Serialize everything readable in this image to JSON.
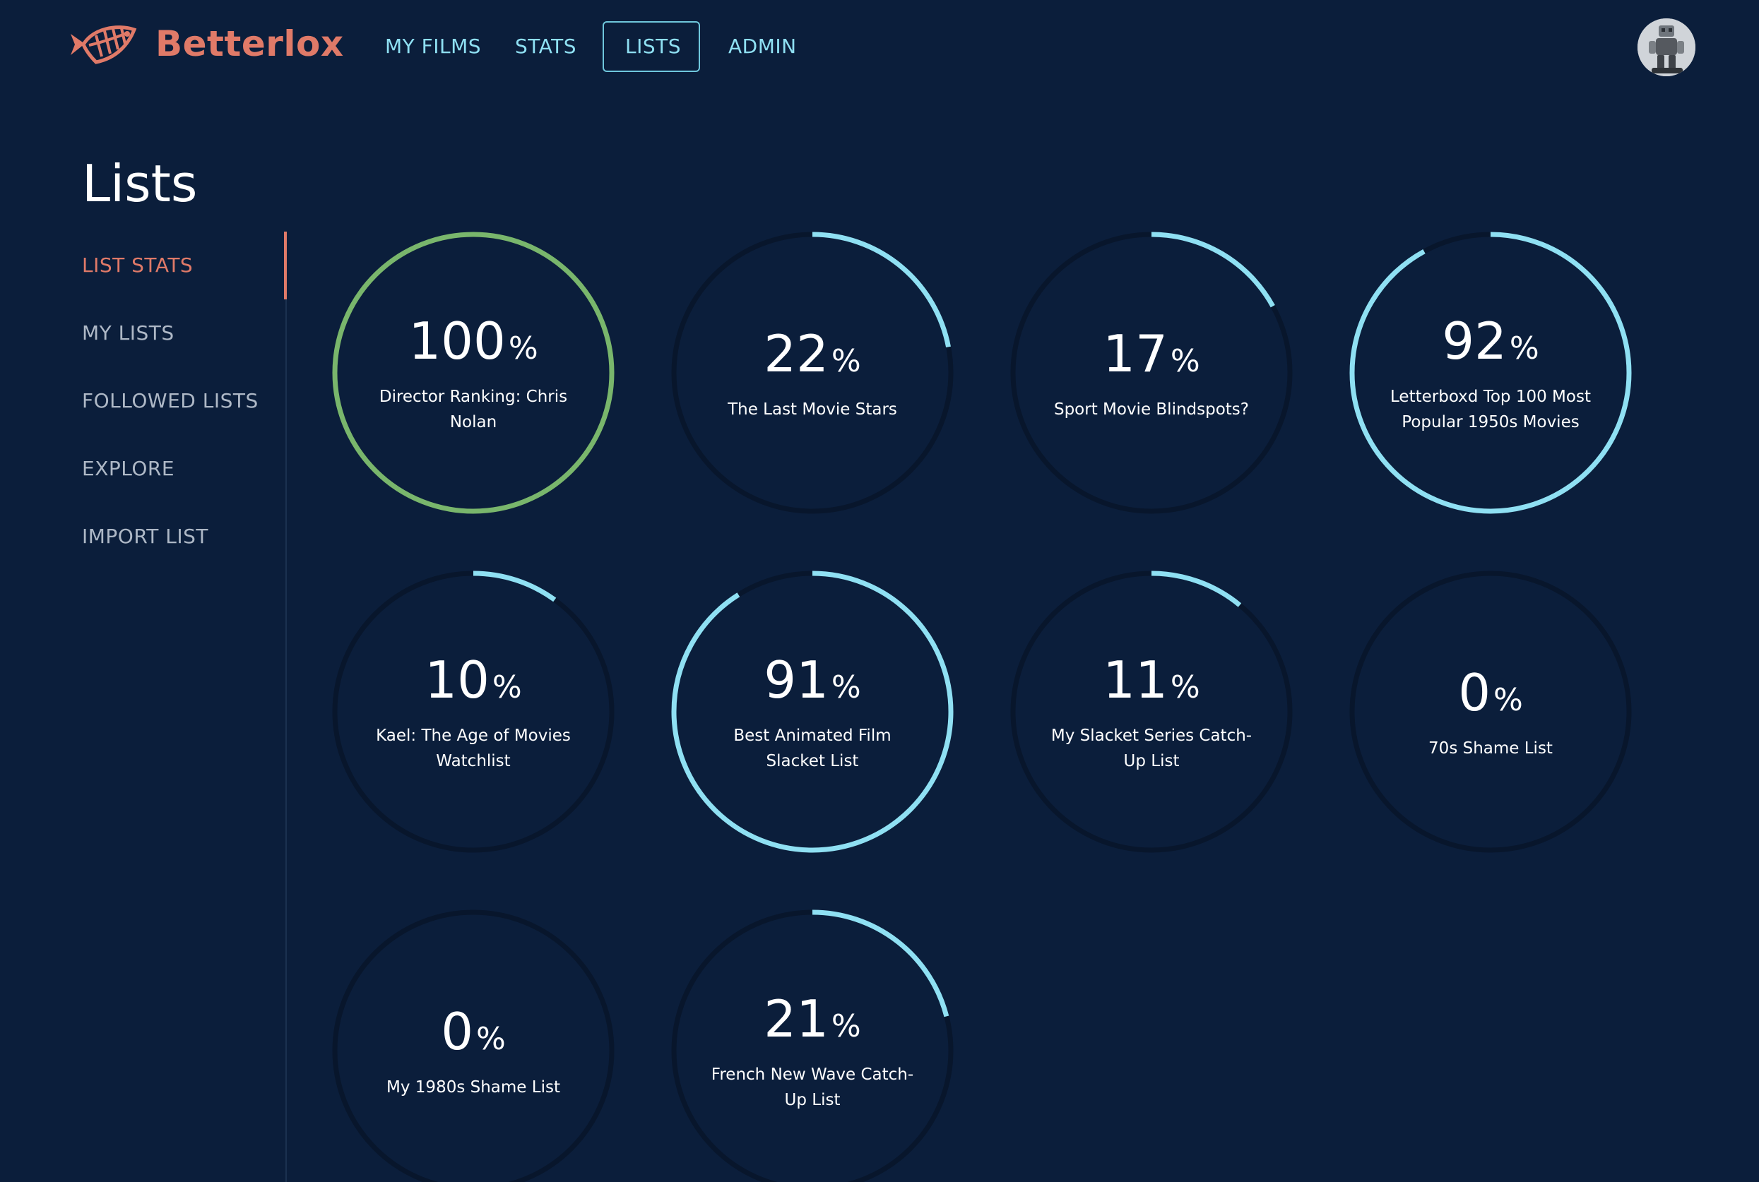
{
  "app": {
    "brand": "Betterlox",
    "logo_icon": "fish-skeleton-icon",
    "avatar_icon": "robot-avatar-icon"
  },
  "nav": {
    "items": [
      {
        "label": "MY FILMS",
        "active": false
      },
      {
        "label": "STATS",
        "active": false
      },
      {
        "label": "LISTS",
        "active": true
      },
      {
        "label": "ADMIN",
        "active": false
      }
    ]
  },
  "page": {
    "title": "Lists"
  },
  "sidebar": {
    "items": [
      {
        "label": "LIST STATS",
        "active": true
      },
      {
        "label": "MY LISTS",
        "active": false
      },
      {
        "label": "FOLLOWED LISTS",
        "active": false
      },
      {
        "label": "EXPLORE",
        "active": false
      },
      {
        "label": "IMPORT LIST",
        "active": false
      }
    ]
  },
  "colors": {
    "background": "#0b1e3b",
    "accent": "#e07a68",
    "nav_text": "#8fe0f3",
    "progress": "#8fe0f3",
    "complete": "#79b66c",
    "track": "#08162c"
  },
  "lists": [
    {
      "name": "Director Ranking: Chris Nolan",
      "percent": 100,
      "complete": true
    },
    {
      "name": "The Last Movie Stars",
      "percent": 22,
      "complete": false
    },
    {
      "name": "Sport Movie Blindspots?",
      "percent": 17,
      "complete": false
    },
    {
      "name": "Letterboxd Top 100 Most Popular 1950s Movies",
      "percent": 92,
      "complete": false
    },
    {
      "name": "Kael: The Age of Movies Watchlist",
      "percent": 10,
      "complete": false
    },
    {
      "name": "Best Animated Film Slacket List",
      "percent": 91,
      "complete": false
    },
    {
      "name": "My Slacket Series Catch-Up List",
      "percent": 11,
      "complete": false
    },
    {
      "name": "70s Shame List",
      "percent": 0,
      "complete": false
    },
    {
      "name": "My 1980s Shame List",
      "percent": 0,
      "complete": false
    },
    {
      "name": "French New Wave Catch-Up List",
      "percent": 21,
      "complete": false
    }
  ],
  "percent_sign": "%"
}
